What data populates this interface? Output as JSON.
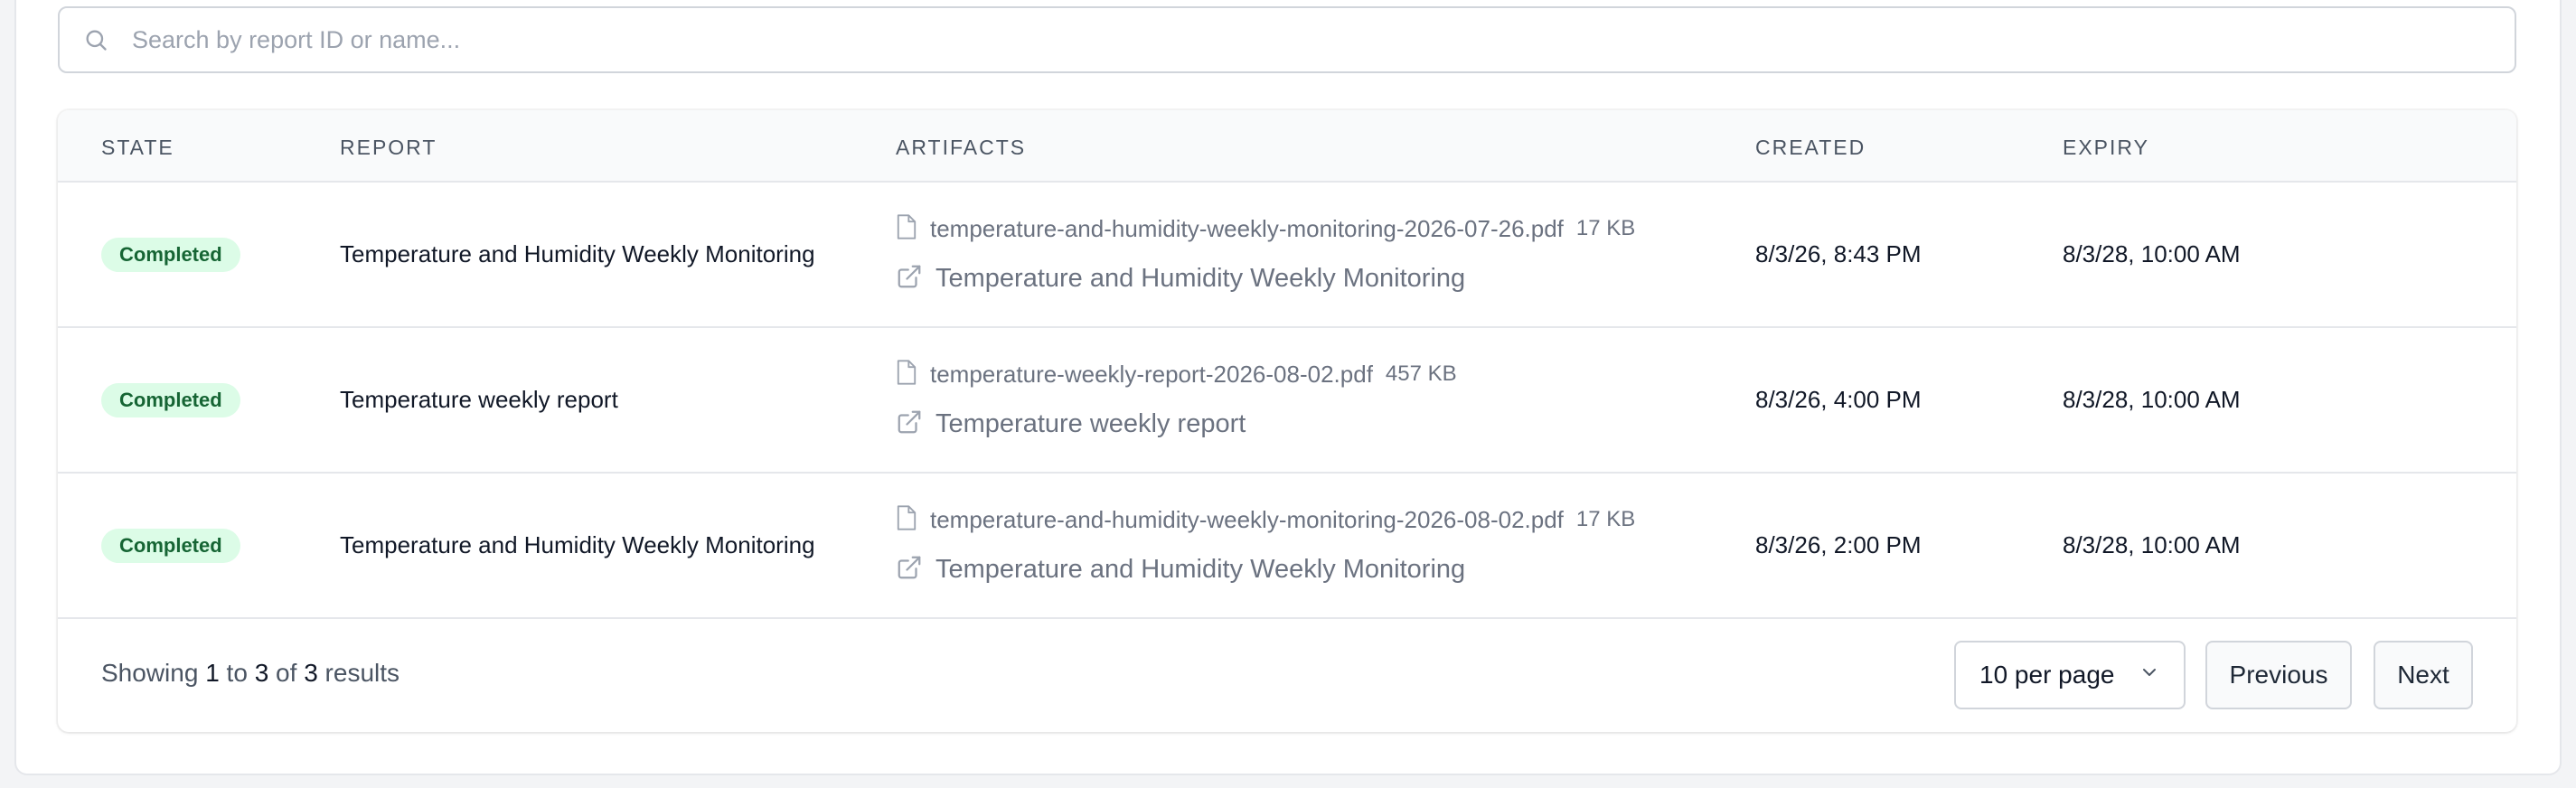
{
  "search": {
    "placeholder": "Search by report ID or name...",
    "icon": "search-icon"
  },
  "table": {
    "headers": {
      "state": "STATE",
      "report": "REPORT",
      "artifacts": "ARTIFACTS",
      "created": "CREATED",
      "expiry": "EXPIRY"
    },
    "rows": [
      {
        "state": "Completed",
        "report": "Temperature and Humidity Weekly Monitoring",
        "file_name": "temperature-and-humidity-weekly-monitoring-2026-07-26.pdf",
        "file_size": "17 KB",
        "link_text": "Temperature and Humidity Weekly Monitoring",
        "created": "8/3/26, 8:43 PM",
        "expiry": "8/3/28, 10:00 AM"
      },
      {
        "state": "Completed",
        "report": "Temperature weekly report",
        "file_name": "temperature-weekly-report-2026-08-02.pdf",
        "file_size": "457 KB",
        "link_text": "Temperature weekly report",
        "created": "8/3/26, 4:00 PM",
        "expiry": "8/3/28, 10:00 AM"
      },
      {
        "state": "Completed",
        "report": "Temperature and Humidity Weekly Monitoring",
        "file_name": "temperature-and-humidity-weekly-monitoring-2026-08-02.pdf",
        "file_size": "17 KB",
        "link_text": "Temperature and Humidity Weekly Monitoring",
        "created": "8/3/26, 2:00 PM",
        "expiry": "8/3/28, 10:00 AM"
      }
    ]
  },
  "footer": {
    "showing_prefix": "Showing",
    "from": "1",
    "to_word": "to",
    "to": "3",
    "of_word": "of",
    "total": "3",
    "results_word": "results",
    "per_page": "10 per page",
    "previous": "Previous",
    "next": "Next"
  },
  "colors": {
    "badge_bg": "#dcfce7",
    "badge_text": "#166534",
    "muted_text": "#6b7280",
    "border": "#e5e7eb"
  }
}
